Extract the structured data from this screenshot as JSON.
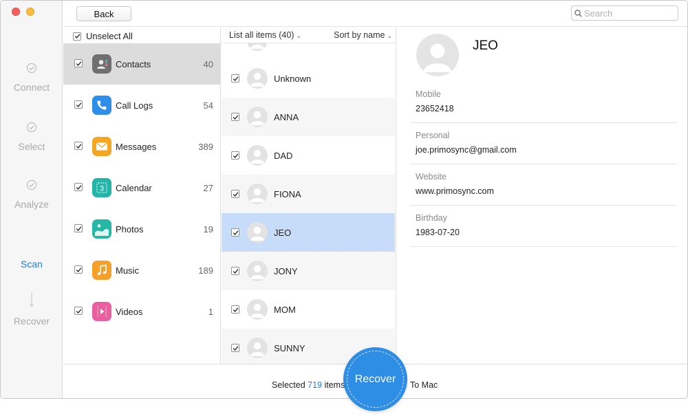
{
  "window": {
    "traffic_lights": [
      "close",
      "minimize"
    ]
  },
  "steps": [
    {
      "label": "Connect",
      "icon": "check-circle-icon",
      "state": "done"
    },
    {
      "label": "Select",
      "icon": "check-circle-icon",
      "state": "done"
    },
    {
      "label": "Analyze",
      "icon": "check-circle-icon",
      "state": "done"
    },
    {
      "label": "Scan",
      "icon": "",
      "state": "active"
    },
    {
      "label": "Recover",
      "icon": "arrow-down-icon",
      "state": "pending"
    }
  ],
  "toolbar": {
    "back_label": "Back",
    "search_placeholder": "Search"
  },
  "categories": {
    "unselect_label": "Unselect All",
    "items": [
      {
        "name": "Contacts",
        "count": "40",
        "icon": "contacts-icon",
        "color": "#6f6f6f",
        "selected": true
      },
      {
        "name": "Call Logs",
        "count": "54",
        "icon": "phone-icon",
        "color": "#2f8fe8",
        "selected": false
      },
      {
        "name": "Messages",
        "count": "389",
        "icon": "envelope-icon",
        "color": "#f5a623",
        "selected": false
      },
      {
        "name": "Calendar",
        "count": "27",
        "icon": "calendar-icon",
        "color": "#22b5a8",
        "selected": false
      },
      {
        "name": "Photos",
        "count": "19",
        "icon": "photos-icon",
        "color": "#25b8a6",
        "selected": false
      },
      {
        "name": "Music",
        "count": "189",
        "icon": "music-note-icon",
        "color": "#f5a02a",
        "selected": false
      },
      {
        "name": "Videos",
        "count": "1",
        "icon": "video-play-icon",
        "color": "#ea5fa0",
        "selected": false
      }
    ]
  },
  "contact_list": {
    "list_all_label": "List all items (40)",
    "sort_label": "Sort by name",
    "items": [
      {
        "name": "Unknown",
        "selected": false
      },
      {
        "name": "ANNA",
        "selected": false
      },
      {
        "name": "DAD",
        "selected": false
      },
      {
        "name": "FIONA",
        "selected": false
      },
      {
        "name": "JEO",
        "selected": true
      },
      {
        "name": "JONY",
        "selected": false
      },
      {
        "name": "MOM",
        "selected": false
      },
      {
        "name": "SUNNY",
        "selected": false
      }
    ]
  },
  "detail": {
    "name": "JEO",
    "fields": [
      {
        "label": "Mobile",
        "value": "23652418"
      },
      {
        "label": "Personal",
        "value": "joe.primosync@gmail.com"
      },
      {
        "label": "Website",
        "value": "www.primosync.com"
      },
      {
        "label": "Birthday",
        "value": "1983-07-20"
      }
    ]
  },
  "bottom": {
    "selected_prefix": "Selected",
    "selected_count": "719",
    "selected_suffix": "items",
    "recover_label": "Recover",
    "to_mac_label": "To Mac"
  },
  "colors": {
    "accent": "#2a7bd9",
    "recover_button": "#2e8de4",
    "selected_row": "#c7dcf8",
    "selected_category": "#dcdcdc"
  }
}
